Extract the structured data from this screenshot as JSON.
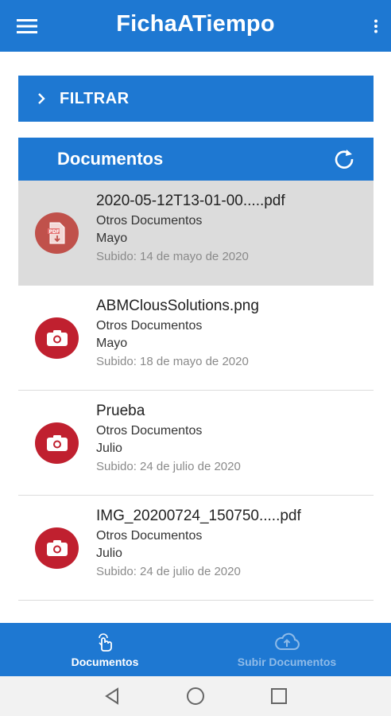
{
  "app": {
    "title": "FichaATiempo",
    "menu_icon": "hamburger-icon",
    "more_icon": "more-vert-icon"
  },
  "filter": {
    "label": "FILTRAR",
    "icon": "chevron-right-icon"
  },
  "documents_section": {
    "label": "Documentos",
    "refresh_icon": "refresh-icon"
  },
  "documents": [
    {
      "name": "2020-05-12T13-01-00.....pdf",
      "category": "Otros Documentos",
      "month": "Mayo",
      "uploaded": "Subido: 14 de mayo de 2020",
      "icon": "pdf-file-icon",
      "selected": true
    },
    {
      "name": "ABMClousSolutions.png",
      "category": "Otros Documentos",
      "month": "Mayo",
      "uploaded": "Subido: 18 de mayo de 2020",
      "icon": "camera-icon",
      "selected": false
    },
    {
      "name": "Prueba",
      "category": "Otros Documentos",
      "month": "Julio",
      "uploaded": "Subido: 24 de julio de 2020",
      "icon": "camera-icon",
      "selected": false
    },
    {
      "name": "IMG_20200724_150750.....pdf",
      "category": "Otros Documentos",
      "month": "Julio",
      "uploaded": "Subido: 24 de julio de 2020",
      "icon": "camera-icon",
      "selected": false
    }
  ],
  "bottom_nav": {
    "items": [
      {
        "label": "Documentos",
        "icon": "touch-hand-icon",
        "active": true
      },
      {
        "label": "Subir Documentos",
        "icon": "cloud-upload-icon",
        "active": false
      }
    ]
  },
  "colors": {
    "primary": "#1e78d2",
    "avatar": "#c0202f",
    "selected_row": "#dcdcdc"
  }
}
